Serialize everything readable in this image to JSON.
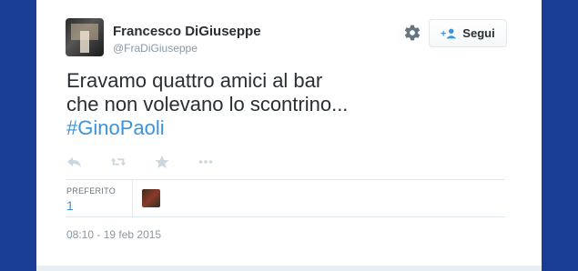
{
  "user": {
    "name": "Francesco DiGiuseppe",
    "handle": "@FraDiGiuseppe"
  },
  "follow": {
    "label": "Segui"
  },
  "tweet": {
    "line1": "Eravamo quattro amici al bar",
    "line2": "che non volevano lo scontrino...",
    "hashtag": "#GinoPaoli"
  },
  "stats": {
    "favorites_label": "PREFERITO",
    "favorites_count": "1"
  },
  "timestamp": "08:10 - 19 feb 2015",
  "icons": {
    "settings": "gear-icon",
    "follow": "add-user-icon",
    "reply": "reply-icon",
    "retweet": "retweet-icon",
    "favorite": "star-icon",
    "more": "more-icon"
  },
  "colors": {
    "link": "#3b94d9",
    "text": "#292f33",
    "muted": "#8899a6",
    "page_bg": "#193d95"
  }
}
